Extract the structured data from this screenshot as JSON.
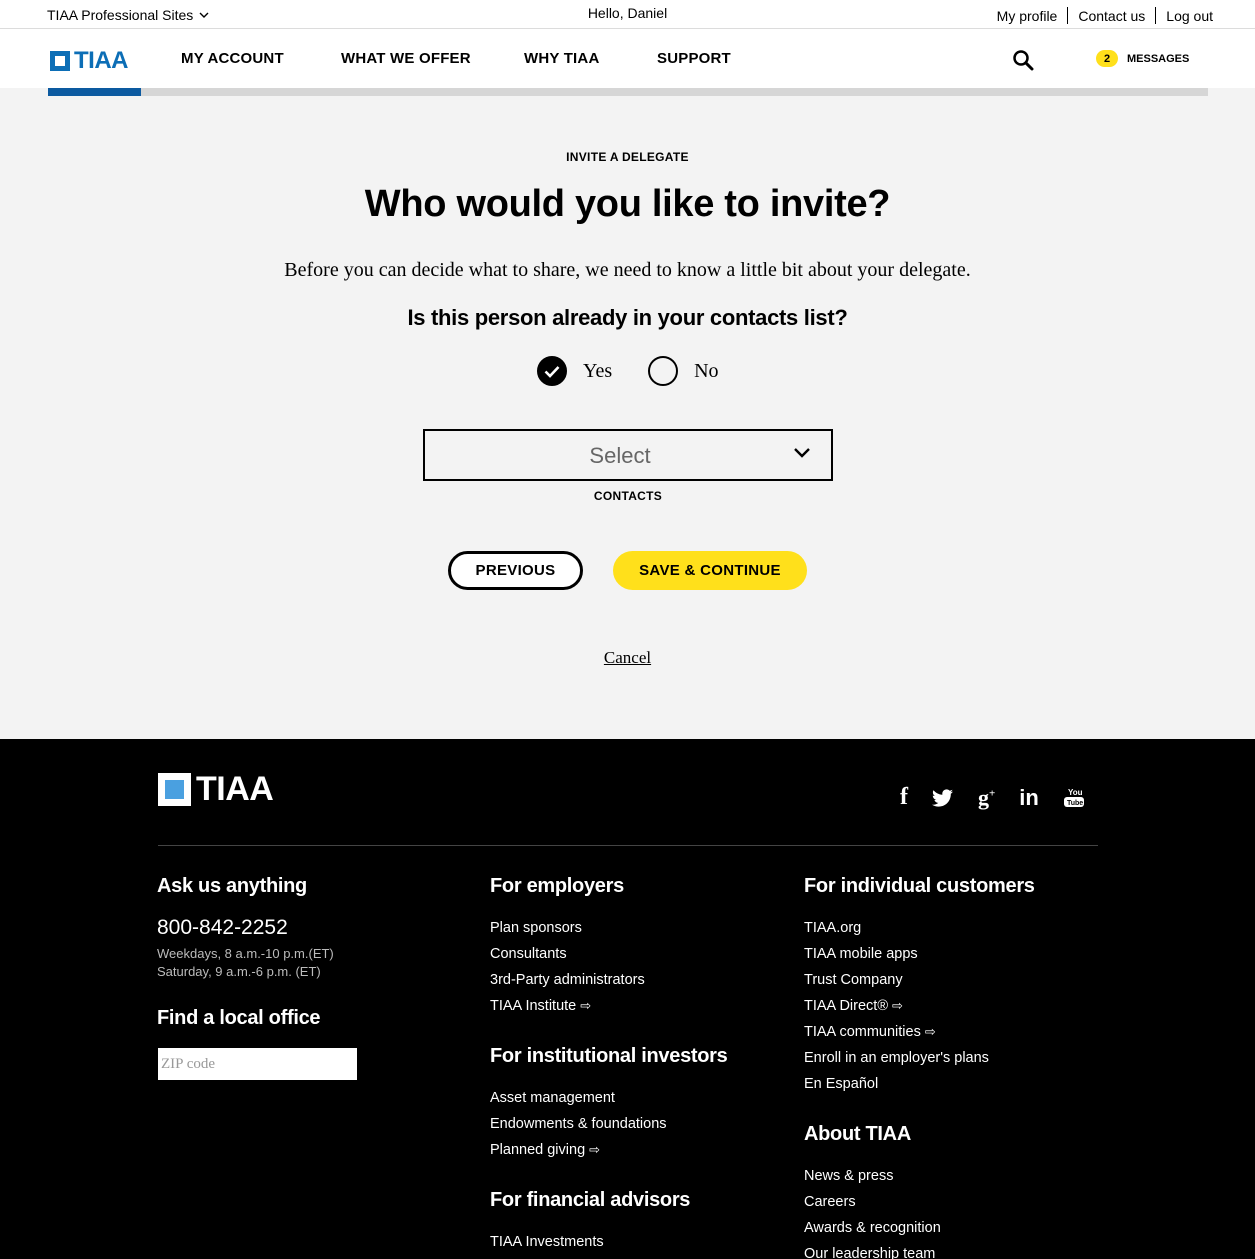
{
  "utility": {
    "sites_label": "TIAA Professional Sites",
    "greeting": "Hello, Daniel",
    "my_profile": "My profile",
    "contact_us": "Contact us",
    "log_out": "Log out"
  },
  "nav": {
    "logo_text": "TIAA",
    "items": [
      "MY ACCOUNT",
      "WHAT WE OFFER",
      "WHY TIAA",
      "SUPPORT"
    ],
    "messages_count": "2",
    "messages_label": "MESSAGES",
    "progress_fraction": 0.08
  },
  "main": {
    "eyebrow": "INVITE A DELEGATE",
    "headline": "Who would you like to invite?",
    "lead": "Before you can decide what to share, we need to know a little bit about your delegate.",
    "question": "Is this person already in your contacts list?",
    "radio_yes": "Yes",
    "radio_no": "No",
    "select_value": "Select",
    "select_label": "CONTACTS",
    "previous": "PREVIOUS",
    "save": "SAVE & CONTINUE",
    "cancel": "Cancel"
  },
  "footer": {
    "logo_text": "TIAA",
    "ask_heading": "Ask us anything",
    "phone": "800-842-2252",
    "hours_weekdays": "Weekdays, 8 a.m.-10 p.m.(ET)",
    "hours_saturday": "Saturday, 9 a.m.-6 p.m. (ET)",
    "local_heading": "Find a local office",
    "zip_placeholder": "ZIP code",
    "employers_heading": "For employers",
    "employers_links": [
      "Plan sponsors",
      "Consultants",
      "3rd-Party administrators",
      "TIAA Institute"
    ],
    "institutional_heading": "For institutional investors",
    "institutional_links": [
      "Asset management",
      "Endowments & foundations",
      "Planned giving"
    ],
    "advisors_heading": "For financial advisors",
    "advisors_links": [
      "TIAA Investments"
    ],
    "individual_heading": "For individual customers",
    "individual_links": [
      "TIAA.org",
      "TIAA mobile apps",
      "Trust Company",
      "TIAA Direct®",
      "TIAA communities",
      "Enroll in an employer's plans",
      "En Español"
    ],
    "about_heading": "About TIAA",
    "about_links": [
      "News & press",
      "Careers",
      "Awards & recognition",
      "Our leadership team"
    ]
  }
}
